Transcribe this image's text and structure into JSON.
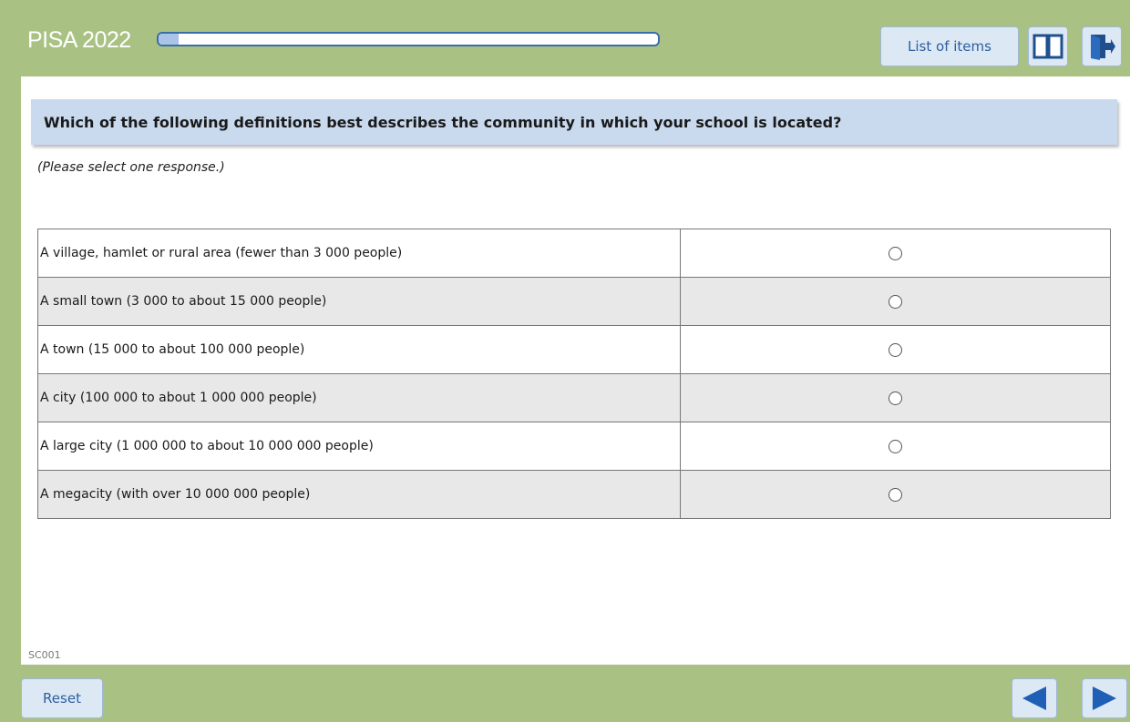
{
  "header": {
    "app_title": "PISA 2022",
    "progress_fraction": 0.04,
    "list_of_items_label": "List of items",
    "book_icon": "book-icon",
    "exit_icon": "exit-door-icon"
  },
  "question": {
    "text": "Which of the following definitions best describes the community in which your school is located?",
    "instruction": "(Please select one response.)"
  },
  "options": [
    {
      "label": "A village, hamlet or rural area (fewer than 3 000 people)",
      "selected": false
    },
    {
      "label": "A small town (3 000 to about 15 000 people)",
      "selected": false
    },
    {
      "label": "A town (15 000 to about 100 000 people)",
      "selected": false
    },
    {
      "label": "A city (100 000 to about 1 000 000 people)",
      "selected": false
    },
    {
      "label": "A large city (1 000 000 to about 10 000 000 people)",
      "selected": false
    },
    {
      "label": "A megacity (with over 10 000 000 people)",
      "selected": false
    }
  ],
  "item_code": "SC001",
  "footer": {
    "reset_label": "Reset",
    "prev_icon": "arrow-left-icon",
    "next_icon": "arrow-right-icon"
  },
  "colors": {
    "frame": "#a9c283",
    "accent_blue": "#2b5fa0",
    "question_bg": "#c9d9ee"
  }
}
